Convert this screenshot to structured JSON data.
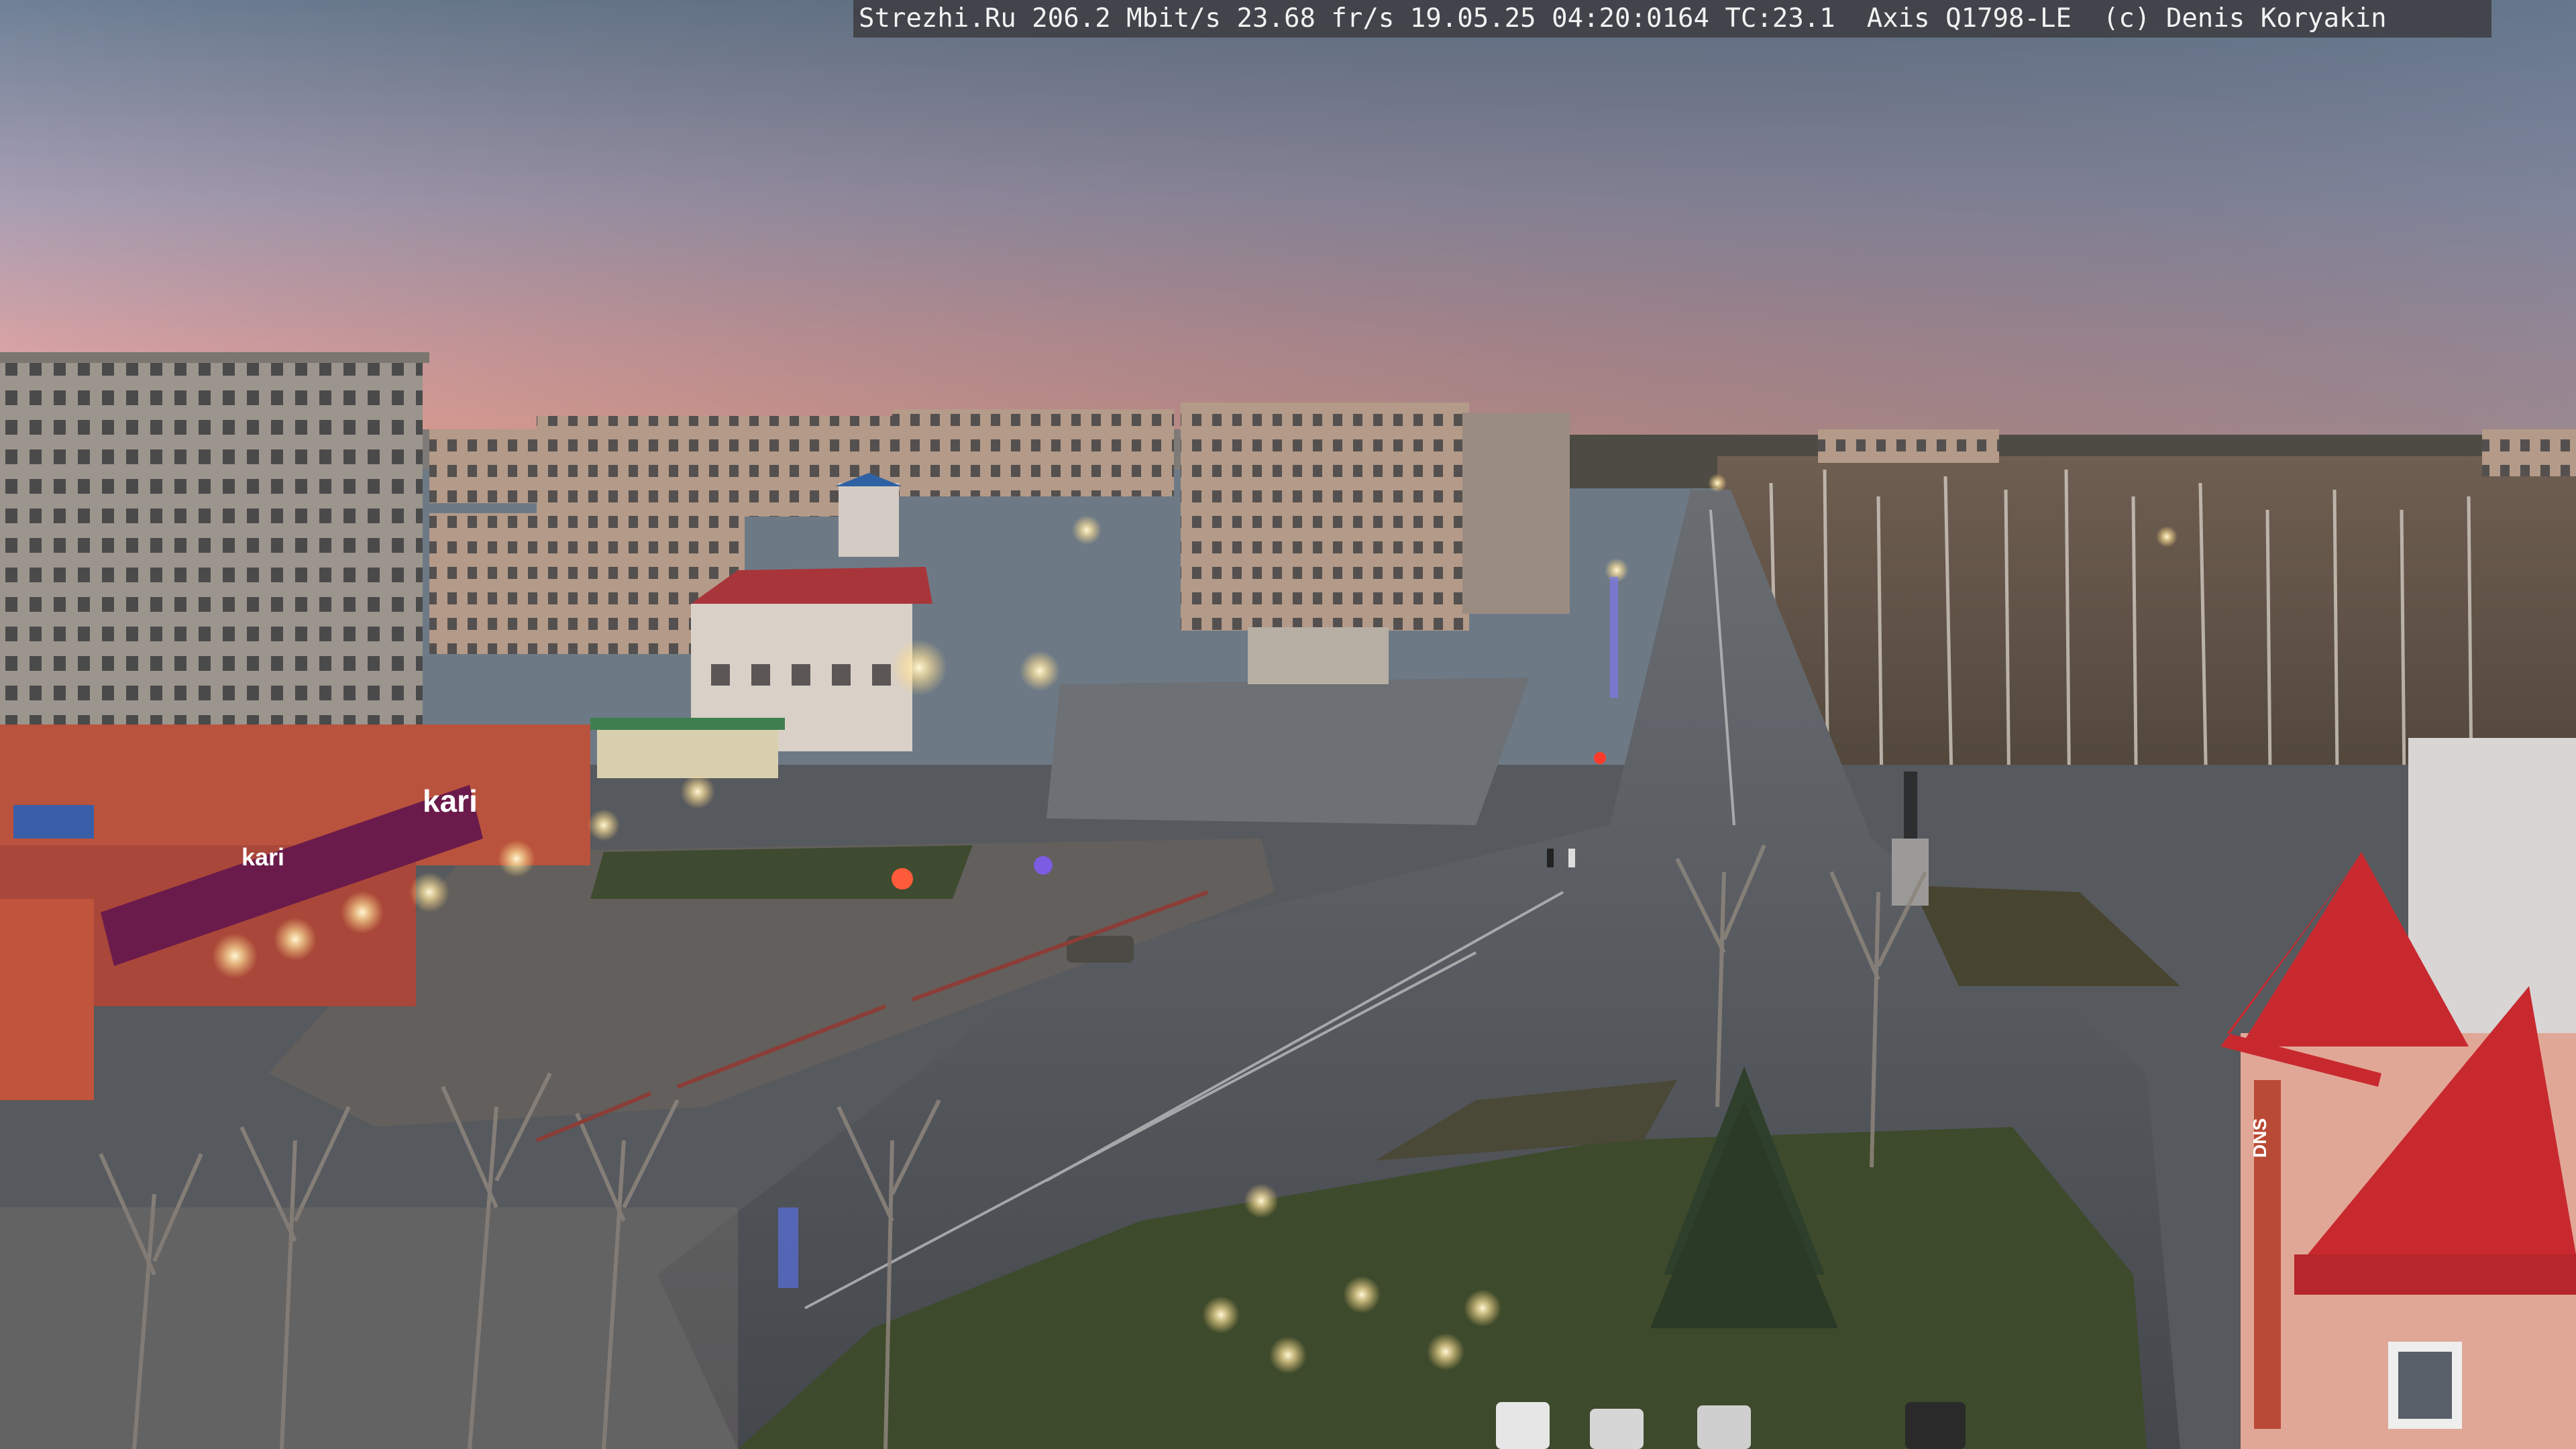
{
  "overlay": {
    "text": "Strezhi.Ru 206.2 Mbit/s 23.68 fr/s 19.05.25 04:20:0164 TC:23.1  Axis Q1798-LE  (c) Denis Koryakin"
  },
  "signs": {
    "store_sign": "kari",
    "store_sign_small": "kari",
    "right_building_sign": "DNS"
  },
  "colors": {
    "sky_top": "#6b7d92",
    "sky_mid": "#b3a3b4",
    "sky_horizon": "#e7a49a",
    "roof_red": "#c8292f",
    "asphalt": "#4a4d52",
    "grass": "#3f4a2e",
    "store_sign_purple": "#6b1b4b"
  }
}
